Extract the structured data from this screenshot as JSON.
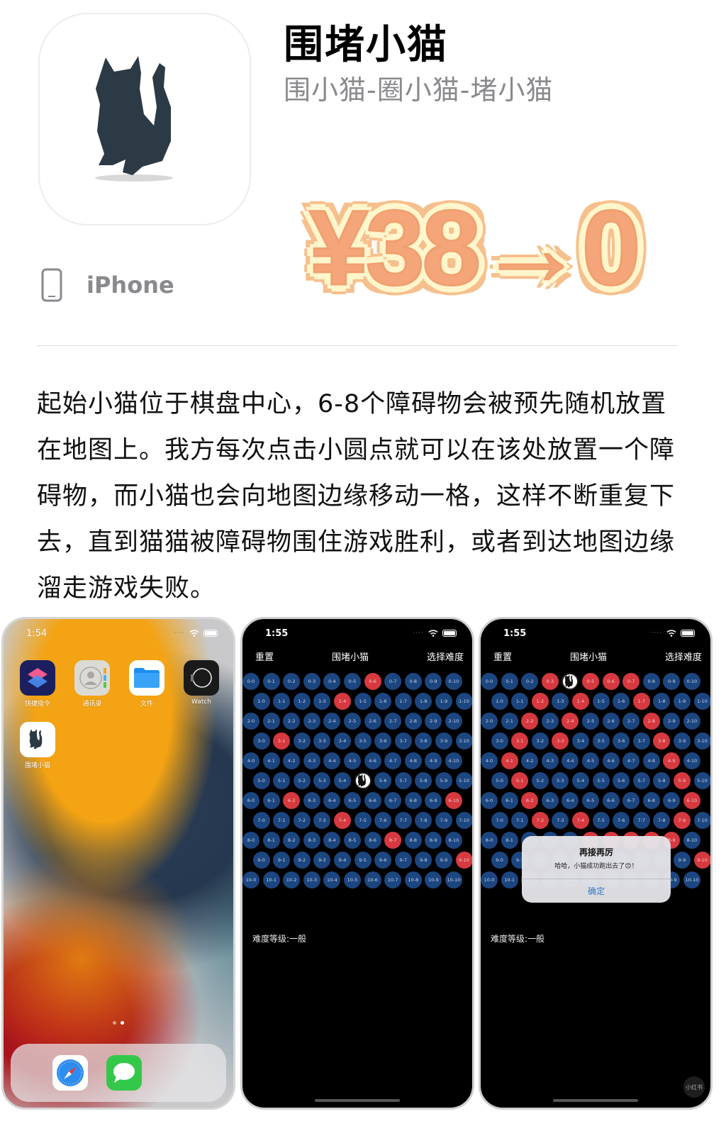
{
  "app": {
    "title": "围堵小猫",
    "subtitle": "围小猫-圈小猫-堵小猫",
    "platform": "iPhone",
    "price_promo": "¥38→0",
    "description": "起始小猫位于棋盘中心，6-8个障碍物会被预先随机放置在地图上。我方每次点击小圆点就可以在该处放置一个障碍物，而小猫也会向地图边缘移动一格，这样不断重复下去，直到猫猫被障碍物围住游戏胜利，或者到达地图边缘溜走游戏失败。"
  },
  "colors": {
    "cell_empty": "#1c4680",
    "cell_blocked": "#d6393f",
    "price_fill": "#f4a67a",
    "price_outline": "#fff6cc",
    "alert_button": "#3478c8"
  },
  "home_screen": {
    "time": "1:54",
    "apps": [
      {
        "label": "快捷指令",
        "icon": "shortcuts-icon"
      },
      {
        "label": "通讯录",
        "icon": "contacts-icon"
      },
      {
        "label": "文件",
        "icon": "files-icon"
      },
      {
        "label": "Watch",
        "icon": "watch-icon"
      },
      {
        "label": "围堵小猫",
        "icon": "cat-app-icon"
      }
    ],
    "dock": [
      {
        "icon": "safari-icon"
      },
      {
        "icon": "messages-icon"
      }
    ]
  },
  "game_screens": [
    {
      "time": "1:55",
      "nav": {
        "reset": "重置",
        "title": "围堵小猫",
        "difficulty_btn": "选择难度"
      },
      "rows": 11,
      "cols": 11,
      "cat": [
        5,
        5
      ],
      "blocked": [
        [
          0,
          6
        ],
        [
          1,
          4
        ],
        [
          3,
          1
        ],
        [
          6,
          2
        ],
        [
          6,
          10
        ],
        [
          7,
          4
        ],
        [
          8,
          7
        ],
        [
          9,
          10
        ]
      ],
      "difficulty_label": "难度等级:一般"
    },
    {
      "time": "1:55",
      "nav": {
        "reset": "重置",
        "title": "围堵小猫",
        "difficulty_btn": "选择难度"
      },
      "rows": 11,
      "cols": 11,
      "cat": [
        0,
        4
      ],
      "blocked": [
        [
          0,
          3
        ],
        [
          0,
          5
        ],
        [
          0,
          6
        ],
        [
          0,
          7
        ],
        [
          1,
          2
        ],
        [
          1,
          4
        ],
        [
          1,
          7
        ],
        [
          2,
          2
        ],
        [
          2,
          4
        ],
        [
          2,
          8
        ],
        [
          3,
          1
        ],
        [
          3,
          3
        ],
        [
          3,
          8
        ],
        [
          4,
          1
        ],
        [
          4,
          9
        ],
        [
          5,
          1
        ],
        [
          5,
          9
        ],
        [
          6,
          2
        ],
        [
          6,
          10
        ],
        [
          7,
          2
        ],
        [
          7,
          4
        ],
        [
          7,
          9
        ],
        [
          8,
          5
        ],
        [
          8,
          6
        ],
        [
          8,
          7
        ],
        [
          8,
          8
        ],
        [
          8,
          9
        ],
        [
          9,
          10
        ]
      ],
      "difficulty_label": "难度等级:一般",
      "alert": {
        "title": "再接再厉",
        "message": "哈哈，小猫成功跑出去了😊！",
        "button": "确定"
      }
    }
  ]
}
